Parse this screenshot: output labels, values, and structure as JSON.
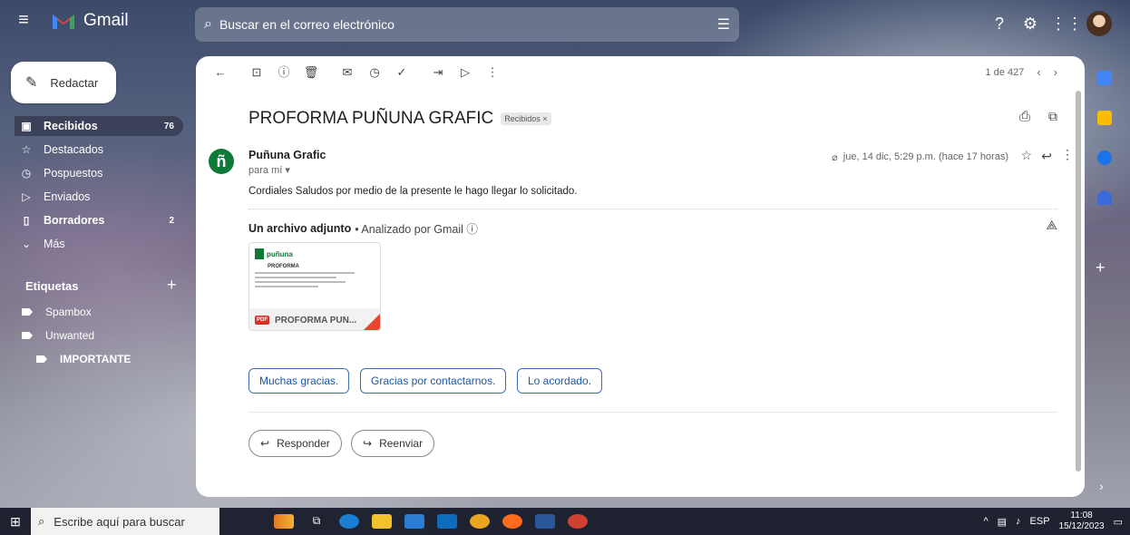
{
  "app": {
    "name": "Gmail"
  },
  "search": {
    "placeholder": "Buscar en el correo electrónico"
  },
  "compose": {
    "label": "Redactar"
  },
  "nav": [
    {
      "label": "Recibidos",
      "count": "76"
    },
    {
      "label": "Destacados",
      "count": ""
    },
    {
      "label": "Pospuestos",
      "count": ""
    },
    {
      "label": "Enviados",
      "count": ""
    },
    {
      "label": "Borradores",
      "count": "2"
    },
    {
      "label": "Más",
      "count": ""
    }
  ],
  "labels": {
    "title": "Etiquetas",
    "items": [
      "Spambox",
      "Unwanted",
      "IMPORTANTE"
    ]
  },
  "pager": {
    "text": "1 de 427"
  },
  "email": {
    "subject": "PROFORMA PUÑUNA GRAFIC",
    "badge": "Recibidos ×",
    "sender": "Puñuna Grafic",
    "to": "para mí ▾",
    "date": "jue, 14 dic, 5:29 p.m. (hace 17 horas)",
    "body": "Cordiales Saludos por medio de la presente le hago llegar lo solicitado."
  },
  "attachments": {
    "heading": "Un archivo adjunto",
    "scanned": "• Analizado por Gmail ⓘ",
    "file": {
      "name": "PROFORMA PUN...",
      "type": "PDF",
      "brand": "puñuna",
      "doc_title": "PROFORMA"
    }
  },
  "smart_replies": [
    "Muchas gracias.",
    "Gracias por contactarnos.",
    "Lo acordado."
  ],
  "actions": {
    "reply": "Responder",
    "forward": "Reenviar"
  },
  "taskbar": {
    "search_placeholder": "Escribe aquí para buscar",
    "lang": "ESP",
    "time": "11:08",
    "date": "15/12/2023"
  },
  "colors": {
    "sender_avatar": "#0e7a37",
    "smart_reply": "#1a57a6",
    "pdf": "#d93025"
  }
}
